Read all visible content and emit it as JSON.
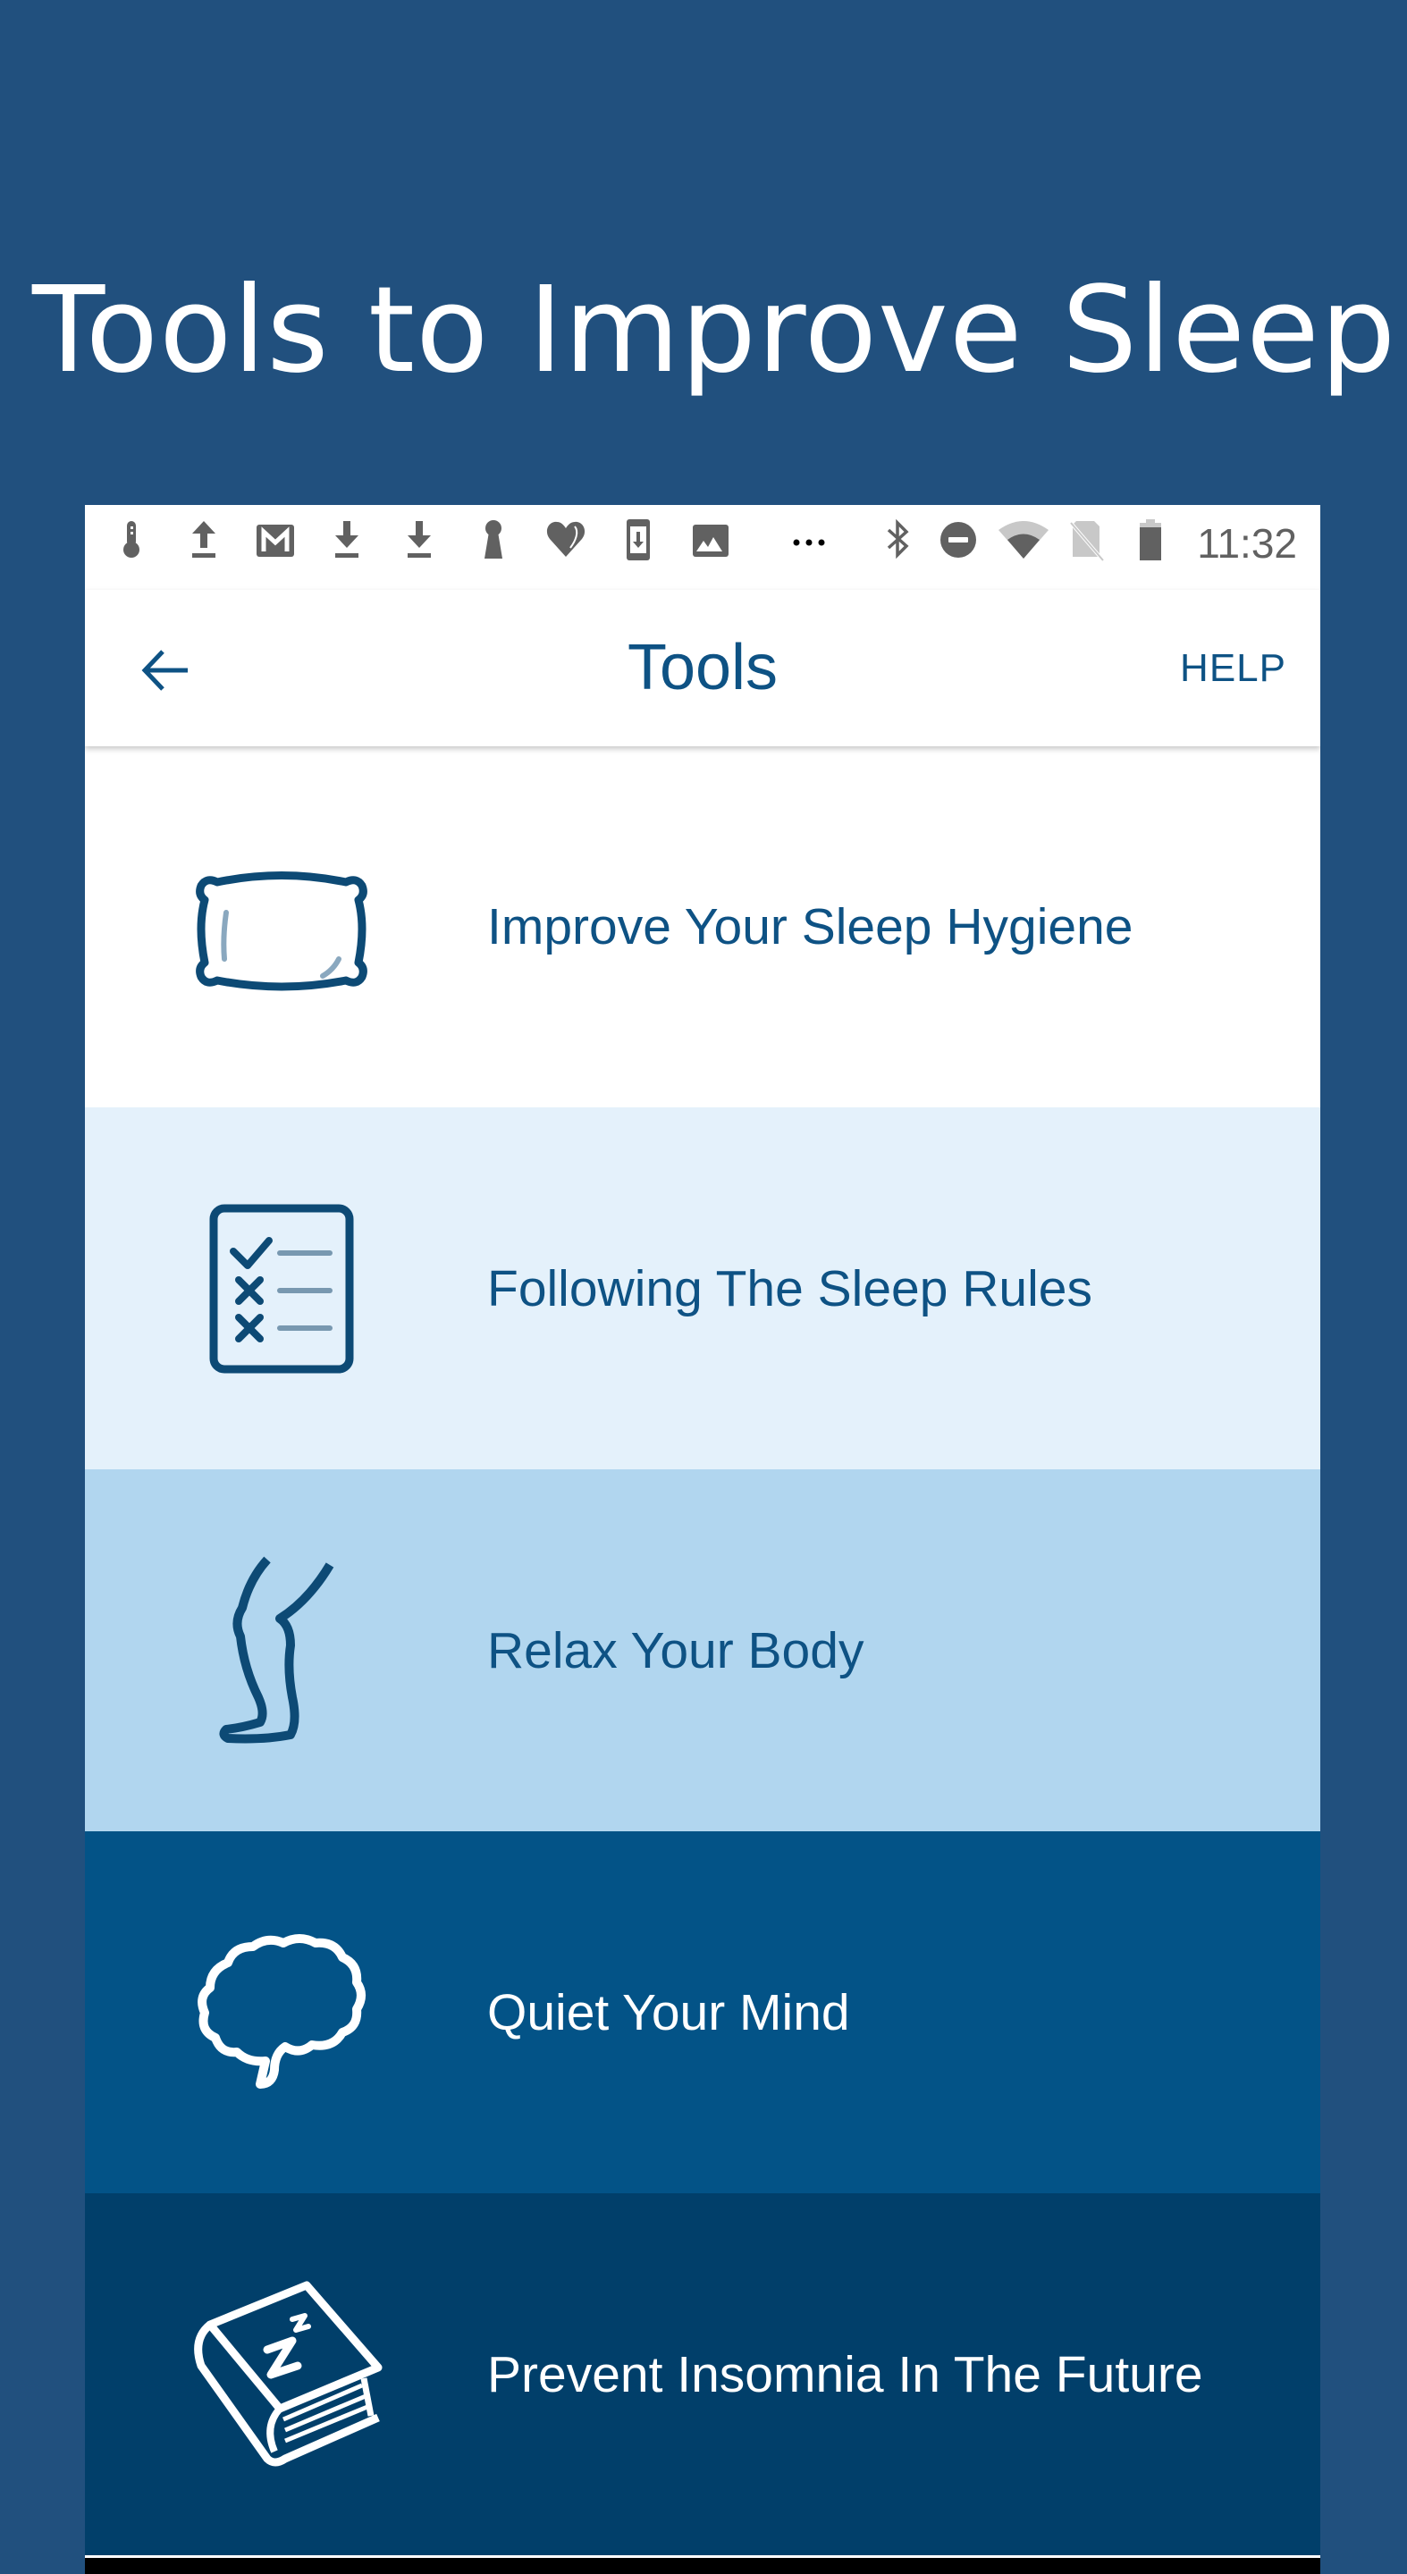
{
  "promo": {
    "headline": "Tools to Improve Sleep."
  },
  "status_bar": {
    "time": "11:32",
    "left_icons": [
      "thermometer-icon",
      "upload-icon",
      "gmail-icon",
      "download-icon",
      "download-icon",
      "keyhole-icon",
      "heart-icon",
      "phone-download-icon",
      "image-icon",
      "more-dots-icon"
    ],
    "right_icons": [
      "bluetooth-icon",
      "do-not-disturb-icon",
      "wifi-icon",
      "no-sim-icon",
      "battery-icon"
    ]
  },
  "app_bar": {
    "title": "Tools",
    "help_label": "HELP",
    "back_icon": "arrow-left-icon"
  },
  "tools": [
    {
      "label": "Improve Your Sleep Hygiene",
      "icon": "pillow-icon",
      "background": "#ffffff",
      "text_color": "#0e5284"
    },
    {
      "label": "Following The Sleep Rules",
      "icon": "checklist-icon",
      "background": "#e4f1fb",
      "text_color": "#0e5284"
    },
    {
      "label": "Relax Your Body",
      "icon": "leg-icon",
      "background": "#b1d6ef",
      "text_color": "#0e5284"
    },
    {
      "label": "Quiet Your Mind",
      "icon": "brain-icon",
      "background": "#035387",
      "text_color": "#ffffff"
    },
    {
      "label": "Prevent Insomnia In The Future",
      "icon": "sleep-book-icon",
      "background": "#013f6a",
      "text_color": "#ffffff"
    }
  ],
  "colors": {
    "page_background": "#21507e",
    "brand_blue": "#0e5284",
    "icon_dark": "#0d4a75",
    "icon_accent": "#8aa8bf",
    "status_gray": "#616161"
  }
}
